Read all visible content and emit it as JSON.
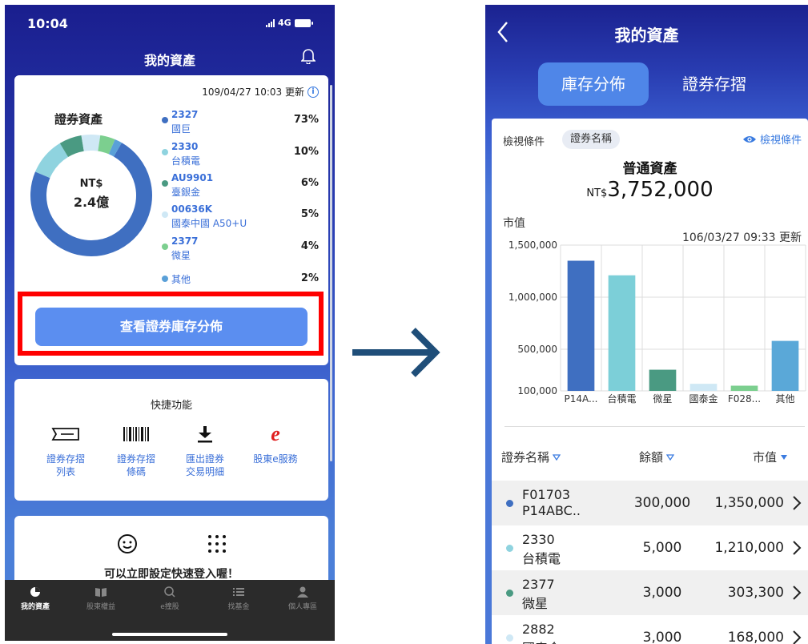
{
  "left": {
    "status_time": "10:04",
    "network": "4G",
    "title": "我的資產",
    "update_time": "109/04/27 10:03 更新",
    "info_glyph": "i",
    "section_title": "證券資產",
    "donut_currency": "NT$",
    "donut_value": "2.4億",
    "holdings": [
      {
        "code": "2327",
        "name": "國巨",
        "pct": "73%",
        "color": "#3f6fc1",
        "share": 73
      },
      {
        "code": "2330",
        "name": "台積電",
        "pct": "10%",
        "color": "#8fd3df",
        "share": 10
      },
      {
        "code": "AU9901",
        "name": "臺銀金",
        "pct": "6%",
        "color": "#4a9a82",
        "share": 6
      },
      {
        "code": "00636K",
        "name": "國泰中國 A50+U",
        "pct": "5%",
        "color": "#cfe8f5",
        "share": 5
      },
      {
        "code": "2377",
        "name": "微星",
        "pct": "4%",
        "color": "#7ccf8f",
        "share": 4
      },
      {
        "code": "",
        "name": "其他",
        "pct": "2%",
        "color": "#5aa0d8",
        "share": 2
      }
    ],
    "primary_button": "查看證券庫存分佈",
    "quick_title": "快捷功能",
    "quick_items": [
      {
        "line1": "證券存摺",
        "line2": "列表",
        "icon": "passbook-icon"
      },
      {
        "line1": "證券存摺",
        "line2": "條碼",
        "icon": "barcode-icon"
      },
      {
        "line1": "匯出證券",
        "line2": "交易明細",
        "icon": "download-icon"
      },
      {
        "line1": "股東e服務",
        "line2": "",
        "icon": "e-service-icon"
      }
    ],
    "quick_login_text": "可以立即設定快速登入喔！",
    "tabs": [
      "我的資產",
      "股東權益",
      "e撞股",
      "找基金",
      "個人專區"
    ],
    "e_glyph": "e"
  },
  "right": {
    "title": "我的資產",
    "seg_tabs": [
      "庫存分佈",
      "證券存摺"
    ],
    "filter_label": "檢視條件",
    "filter_chip": "證券名稱",
    "filter_link": "檢視條件",
    "total_title": "普通資產",
    "total_currency": "NT$",
    "total_value": "3,752,000",
    "mv_label": "市值",
    "mv_update": "106/03/27 09:33 更新",
    "columns": [
      "證券名稱",
      "餘額",
      "市值"
    ],
    "rows": [
      {
        "code": "F01703",
        "name": "P14ABC..",
        "balance": "300,000",
        "value": "1,350,000",
        "color": "#3f6fc1"
      },
      {
        "code": "2330",
        "name": "台積電",
        "balance": "5,000",
        "value": "1,210,000",
        "color": "#8fd3df"
      },
      {
        "code": "2377",
        "name": "微星",
        "balance": "3,000",
        "value": "303,300",
        "color": "#4a9a82"
      },
      {
        "code": "2882",
        "name": "國泰金",
        "balance": "3,000",
        "value": "168,000",
        "color": "#cfe8f5"
      }
    ]
  },
  "chart_data": {
    "type": "bar",
    "categories": [
      "P14A...",
      "台積電",
      "微星",
      "國泰金",
      "F028...",
      "其他"
    ],
    "values": [
      1350000,
      1210000,
      303300,
      168000,
      150000,
      580000
    ],
    "colors": [
      "#3f6fc1",
      "#7ccfd8",
      "#4a9a82",
      "#cfe8f5",
      "#7ccf8f",
      "#5aa8d8"
    ],
    "ytick_labels": [
      "1,500,000",
      "1,000,000",
      "500,000",
      "100,000"
    ],
    "yticks": [
      1500000,
      1000000,
      500000,
      100000
    ],
    "ylim": [
      100000,
      1500000
    ],
    "ylabel": "市值",
    "grid": true
  }
}
